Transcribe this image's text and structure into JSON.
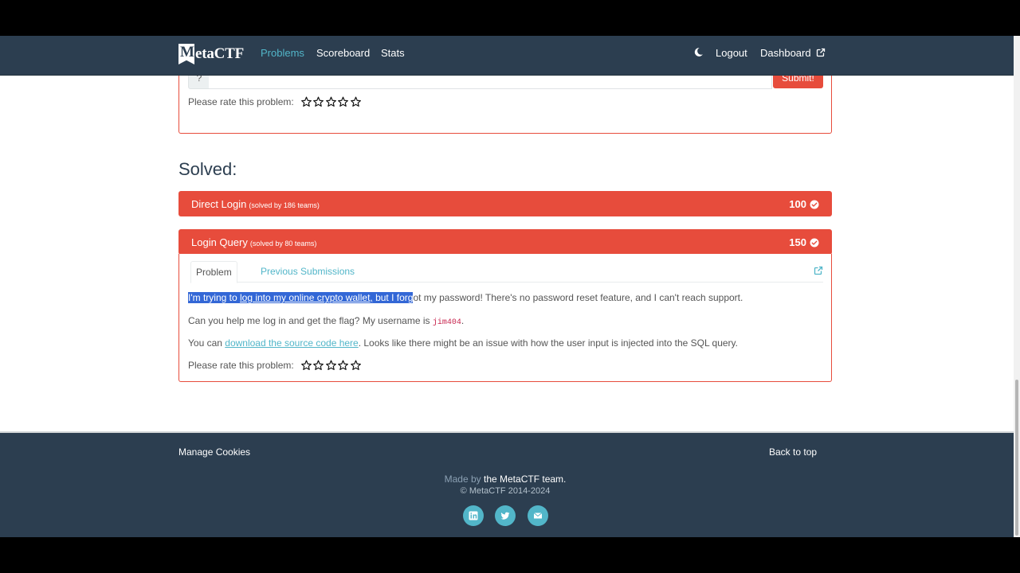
{
  "nav": {
    "logo_initial": "M",
    "logo_rest": "etaCTF",
    "problems": "Problems",
    "scoreboard": "Scoreboard",
    "stats": "Stats",
    "logout": "Logout",
    "dashboard": "Dashboard"
  },
  "top_panel": {
    "flag_addon": "?",
    "flag_value": "",
    "submit": "Submit!",
    "rate_label": "Please rate this problem:",
    "rating": 0,
    "rating_max": 5
  },
  "solved_heading": "Solved:",
  "problems": [
    {
      "name": "Direct Login",
      "solved_text": "(solved by 186 teams)",
      "points": "100"
    },
    {
      "name": "Login Query",
      "solved_text": "(solved by 80 teams)",
      "points": "150"
    }
  ],
  "problem_detail": {
    "tab_problem": "Problem",
    "tab_previous": "Previous Submissions",
    "p1_highlight_a": "I'm trying to ",
    "p1_highlight_link": "log into my online crypto wallet,",
    "p1_highlight_b": " but I forg",
    "p1_rest": "ot my password! There's no password reset feature, and I can't reach support.",
    "p2_text": "Can you help me log in and get the flag? My username is ",
    "p2_username": "jim404",
    "p2_end": ".",
    "p3_start": "You can ",
    "p3_link": "download the source code here",
    "p3_end": ". Looks like there might be an issue with how the user input is injected into the SQL query.",
    "rate_label": "Please rate this problem:",
    "rating": 0,
    "rating_max": 5
  },
  "footer": {
    "manage_cookies": "Manage Cookies",
    "back_to_top": "Back to top",
    "made_by_label": "Made by",
    "made_by_team": "the MetaCTF team.",
    "copyright": "© MetaCTF 2014-2024"
  },
  "colors": {
    "navbar": "#2c3e50",
    "accent": "#e74c3c",
    "link": "#52b6c9",
    "selection": "#3367d6"
  },
  "icons": [
    "moon-icon",
    "external-link-icon",
    "check-circle-icon",
    "star-outline-icon",
    "linkedin-icon",
    "twitter-icon",
    "envelope-icon"
  ]
}
